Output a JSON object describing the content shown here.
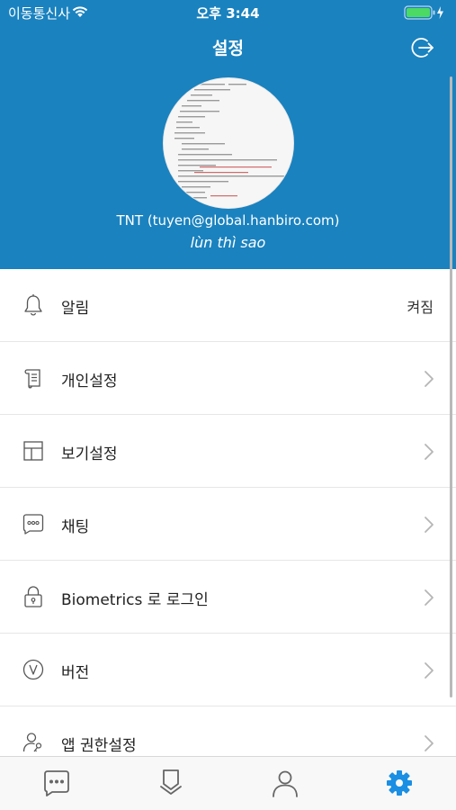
{
  "status_bar": {
    "carrier": "이동통신사",
    "time": "오후 3:44"
  },
  "header": {
    "title": "설정",
    "account": "TNT (tuyen@global.hanbiro.com)",
    "status_message": "lùn thì sao"
  },
  "menu": {
    "items": [
      {
        "label": "알림",
        "value": "켜짐",
        "icon": "bell-icon"
      },
      {
        "label": "개인설정",
        "icon": "scroll-document-icon"
      },
      {
        "label": "보기설정",
        "icon": "layout-grid-icon"
      },
      {
        "label": "채팅",
        "icon": "chat-bubble-icon"
      },
      {
        "label": "Biometrics 로 로그인",
        "icon": "lock-icon"
      },
      {
        "label": "버전",
        "icon": "version-v-icon"
      },
      {
        "label": "앱 권한설정",
        "icon": "user-key-icon"
      }
    ]
  },
  "tab_bar": {
    "tabs": [
      {
        "icon": "chat-tab-icon"
      },
      {
        "icon": "bookmark-tab-icon"
      },
      {
        "icon": "contacts-tab-icon"
      },
      {
        "icon": "settings-tab-icon",
        "active": true
      }
    ],
    "active_color": "#1a8fe3",
    "inactive_color": "#666666"
  },
  "colors": {
    "header_bg": "#1a82bf"
  }
}
